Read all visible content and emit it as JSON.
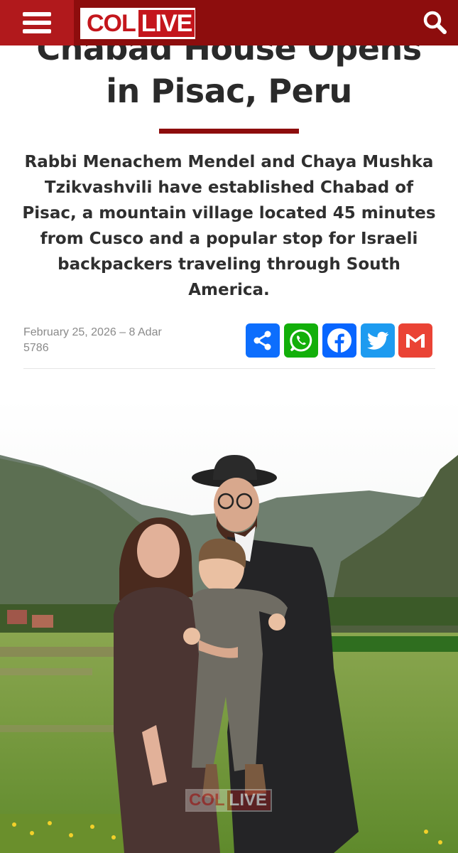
{
  "header": {
    "logo_left": "COL",
    "logo_right": "LIVE",
    "brand_color": "#8d0d0d",
    "menu_color": "#b1191c",
    "menu_icon": "hamburger-menu-icon",
    "search_icon": "search-icon"
  },
  "article": {
    "title_lines": [
      "Chabad House Opens",
      "in Pisac, Peru"
    ],
    "lead": "Rabbi Menachem Mendel and Chaya Mushka Tzikvashvili have established Chabad of Pisac, a mountain village located 45 minutes from Cusco and a popular stop for Israeli backpackers traveling through South America.",
    "date": "February 25, 2026 – 8 Adar 5786"
  },
  "share": {
    "buttons": [
      {
        "icon": "share-icon",
        "color": "#0d6efd"
      },
      {
        "icon": "whatsapp-icon",
        "color": "#12af0a"
      },
      {
        "icon": "facebook-icon",
        "color": "#0866ff"
      },
      {
        "icon": "twitter-icon",
        "color": "#1d9bf0"
      },
      {
        "icon": "gmail-icon",
        "color": "#ea4335"
      }
    ]
  },
  "photo": {
    "watermark_left": "COL",
    "watermark_right": "LIVE"
  }
}
